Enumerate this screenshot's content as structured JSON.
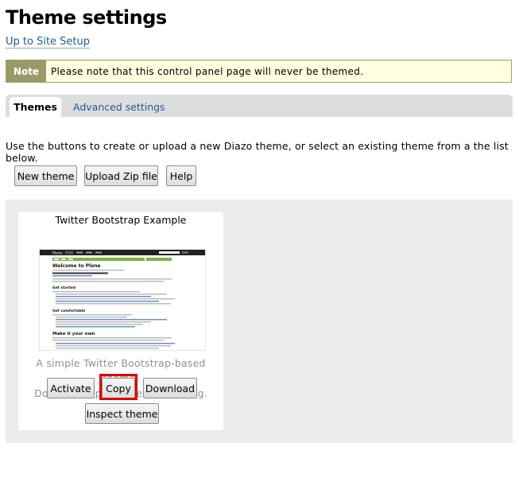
{
  "page": {
    "title": "Theme settings",
    "up_link": "Up to Site Setup"
  },
  "note": {
    "tag": "Note",
    "text": "Please note that this control panel page will never be themed."
  },
  "tabs": [
    {
      "label": "Themes",
      "active": true
    },
    {
      "label": "Advanced settings",
      "active": false
    }
  ],
  "intro": "Use the buttons to create or upload a new Diazo theme, or select an existing theme from a the list below.",
  "actions": {
    "new_theme": "New theme",
    "upload_zip": "Upload Zip file",
    "help": "Help"
  },
  "themes": [
    {
      "title": "Twitter Bootstrap Example",
      "description": "A simple Twitter Bootstrap-based theme.",
      "note": "Does not support themed editing.",
      "buttons": {
        "activate": "Activate",
        "copy": "Copy",
        "download": "Download",
        "inspect": "Inspect theme"
      },
      "preview": {
        "brand": "Plone",
        "heading": "Welcome to Plone",
        "section1": "Get started",
        "section2": "Get comfortable",
        "section3": "Make it your own"
      }
    }
  ],
  "colors": {
    "link": "#205c90",
    "note_bg": "#ffffe1",
    "note_tag_bg": "#9a9a68",
    "panel_bg": "#ececec",
    "highlight": "#e00000"
  }
}
